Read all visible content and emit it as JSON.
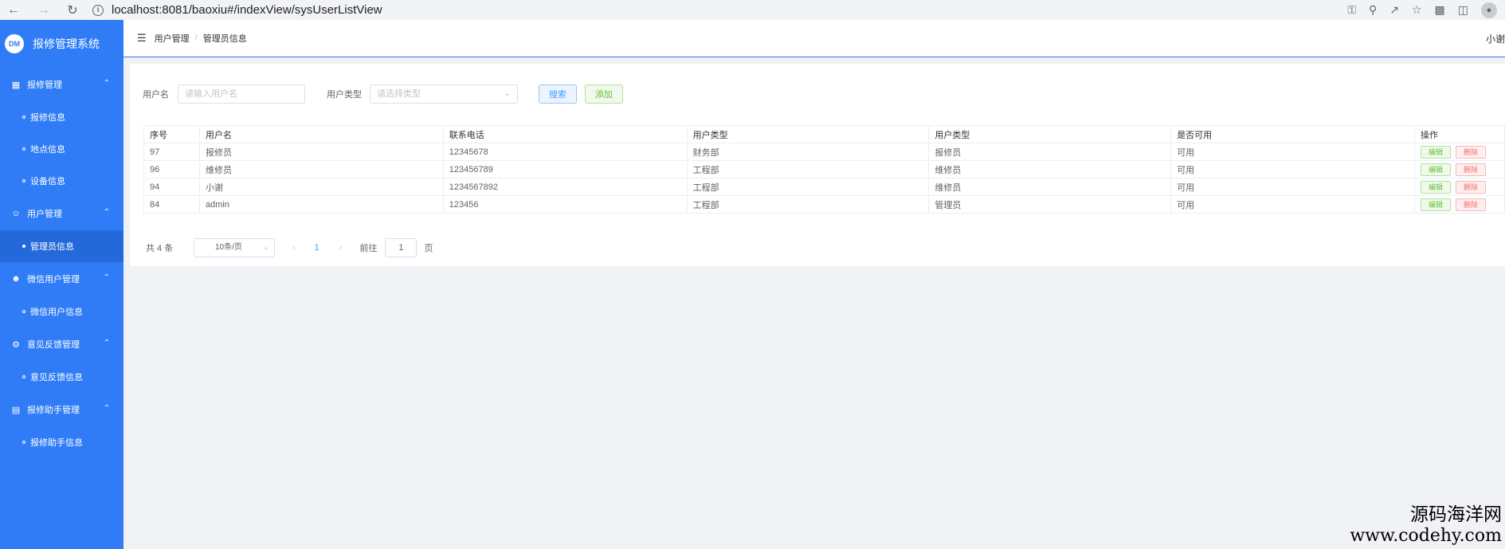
{
  "browser": {
    "url": "localhost:8081/baoxiu#/indexView/sysUserListView",
    "info_icon": "i"
  },
  "sidebar": {
    "logo_badge": "DM",
    "title": "报修管理系统",
    "groups": [
      {
        "label": "报修管理",
        "icon": "chart-icon",
        "items": [
          "报修信息",
          "地点信息",
          "设备信息"
        ]
      },
      {
        "label": "用户管理",
        "icon": "user-icon",
        "items": [
          "管理员信息"
        ]
      },
      {
        "label": "微信用户管理",
        "icon": "person-icon",
        "items": [
          "微信用户信息"
        ]
      },
      {
        "label": "意见反馈管理",
        "icon": "gear-icon",
        "items": [
          "意见反馈信息"
        ]
      },
      {
        "label": "报修助手管理",
        "icon": "box-icon",
        "items": [
          "报修助手信息"
        ]
      }
    ],
    "active_item": "管理员信息"
  },
  "header": {
    "breadcrumb": [
      "用户管理",
      "管理员信息"
    ],
    "separator": "/",
    "user": "小谢"
  },
  "filters": {
    "username_label": "用户名",
    "username_placeholder": "请输入用户名",
    "usertype_label": "用户类型",
    "usertype_placeholder": "请选择类型",
    "search_label": "搜索",
    "add_label": "添加"
  },
  "table": {
    "columns": [
      "序号",
      "用户名",
      "联系电话",
      "用户类型",
      "用户类型",
      "是否可用",
      "操作"
    ],
    "rows": [
      [
        "97",
        "报修员",
        "12345678",
        "财务部",
        "报修员",
        "可用"
      ],
      [
        "96",
        "维修员",
        "123456789",
        "工程部",
        "维修员",
        "可用"
      ],
      [
        "94",
        "小谢",
        "1234567892",
        "工程部",
        "维修员",
        "可用"
      ],
      [
        "84",
        "admin",
        "123456",
        "工程部",
        "管理员",
        "可用"
      ]
    ],
    "edit_label": "编辑",
    "delete_label": "删除"
  },
  "pagination": {
    "total": "共 4 条",
    "page_size": "10条/页",
    "current_page": "1",
    "goto_label": "前往",
    "goto_value": "1",
    "page_suffix": "页"
  },
  "watermark": {
    "line1": "源码海洋网",
    "line2": "www.codehy.com"
  },
  "colors": {
    "sidebar": "#2f7cf6",
    "sidebar_active": "#2469d9",
    "primary": "#409eff",
    "success": "#67c23a",
    "danger": "#f56c6c"
  }
}
